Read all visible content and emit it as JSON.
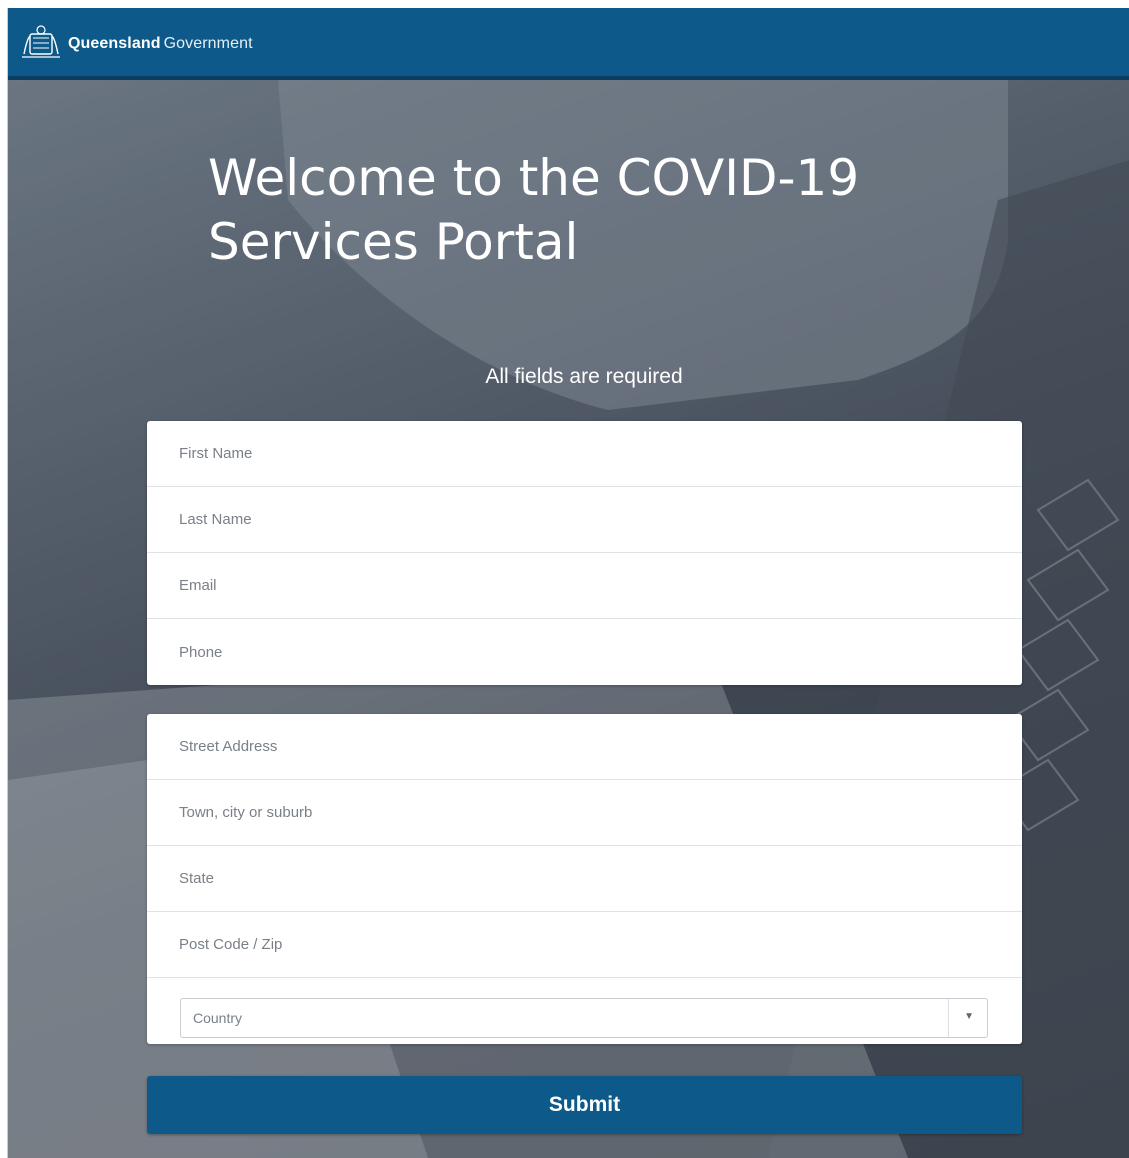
{
  "header": {
    "brand_strong": "Queensland",
    "brand_light": "Government",
    "logo_icon": "queensland-crest-icon",
    "background_color": "#0d5a8a"
  },
  "hero": {
    "title": "Welcome to the COVID-19 Services Portal",
    "required_note": "All fields are required"
  },
  "personal_fields": [
    {
      "placeholder": "First Name",
      "value": ""
    },
    {
      "placeholder": "Last Name",
      "value": ""
    },
    {
      "placeholder": "Email",
      "value": ""
    },
    {
      "placeholder": "Phone",
      "value": ""
    }
  ],
  "address_fields": [
    {
      "placeholder": "Street Address",
      "value": ""
    },
    {
      "placeholder": "Town, city or suburb",
      "value": ""
    },
    {
      "placeholder": "State",
      "value": ""
    },
    {
      "placeholder": "Post Code / Zip",
      "value": ""
    }
  ],
  "country_select": {
    "selected": "Country",
    "arrow_icon": "dropdown-triangle-icon"
  },
  "submit": {
    "label": "Submit",
    "color": "#0d5a8a"
  }
}
